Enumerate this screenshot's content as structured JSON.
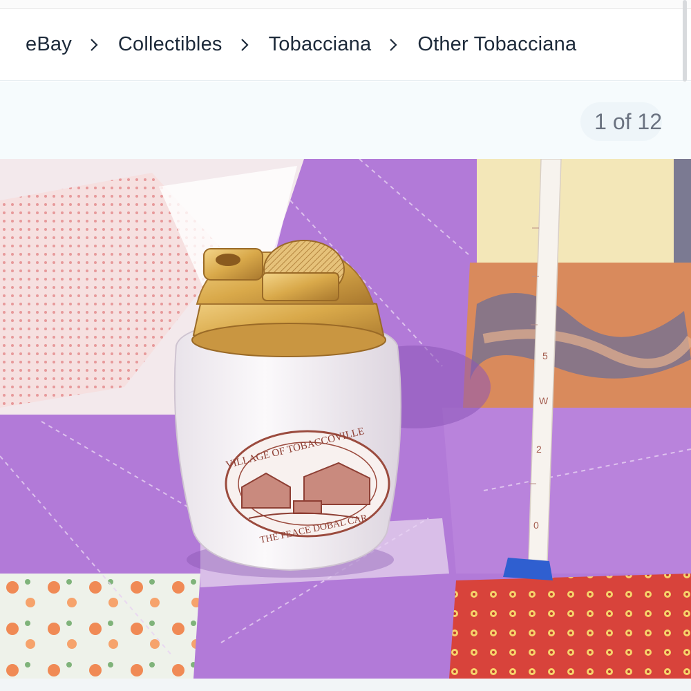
{
  "breadcrumb": {
    "items": [
      {
        "label": "eBay"
      },
      {
        "label": "Collectibles"
      },
      {
        "label": "Tobacciana"
      },
      {
        "label": "Other Tobacciana"
      }
    ],
    "separator_icon": "chevron-right-icon"
  },
  "gallery": {
    "counter": "1 of 12",
    "current": 1,
    "total": 12
  },
  "image": {
    "logo_top": "VILLAGE OF TOBACCOVILLE",
    "logo_bottom": "THE PEACE DOBAL CAR"
  },
  "colors": {
    "purple_quilt": "#b27ad8",
    "text": "#1d2a3a",
    "counter_text": "#6a7280",
    "gold": "#d9a94a"
  }
}
